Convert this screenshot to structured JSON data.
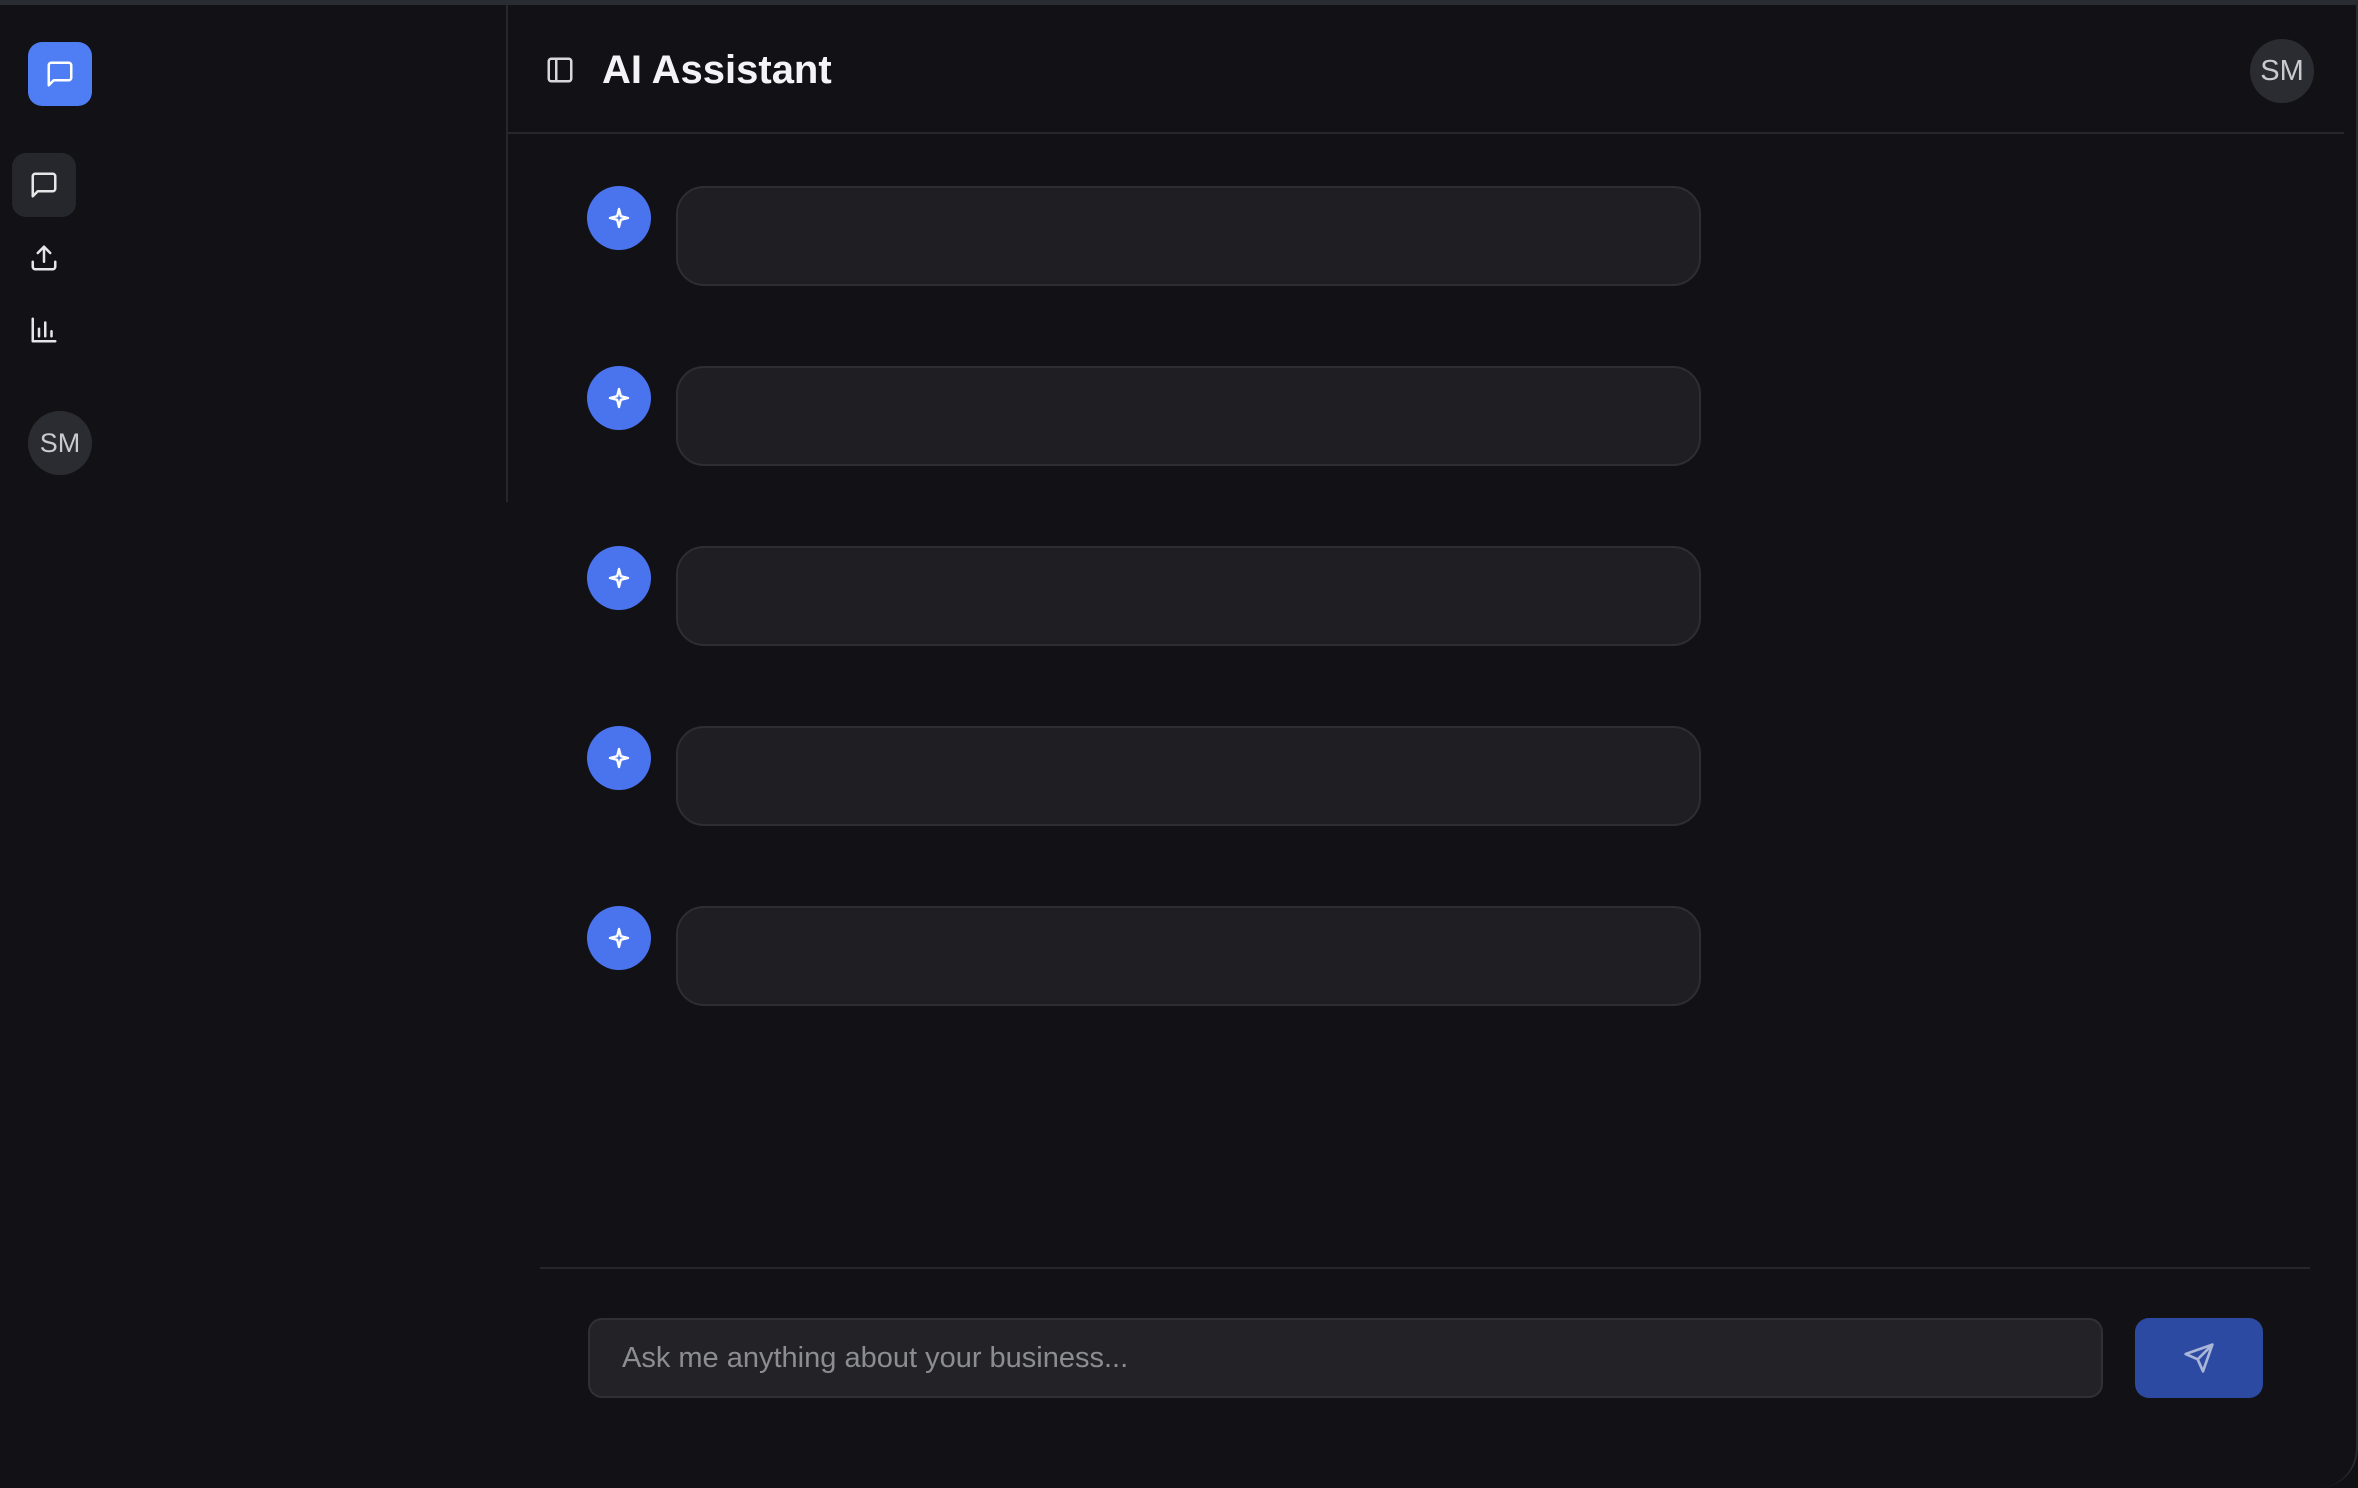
{
  "header": {
    "title": "AI Assistant",
    "avatar_initials": "SM"
  },
  "sidebar": {
    "logo_icon": "message-square-icon",
    "items": [
      {
        "id": "chat",
        "icon": "message-square-icon",
        "active": true
      },
      {
        "id": "upload",
        "icon": "upload-icon",
        "active": false
      },
      {
        "id": "analytics",
        "icon": "bar-chart-icon",
        "active": false
      }
    ],
    "avatar_initials": "SM"
  },
  "messages": [
    {
      "role": "assistant",
      "icon": "sparkle-icon",
      "text": ""
    },
    {
      "role": "assistant",
      "icon": "sparkle-icon",
      "text": ""
    },
    {
      "role": "assistant",
      "icon": "sparkle-icon",
      "text": ""
    },
    {
      "role": "assistant",
      "icon": "sparkle-icon",
      "text": ""
    },
    {
      "role": "assistant",
      "icon": "sparkle-icon",
      "text": ""
    }
  ],
  "composer": {
    "placeholder": "Ask me anything about your business...",
    "value": "",
    "send_icon": "send-icon"
  },
  "colors": {
    "accent": "#4f7df3",
    "send_button": "#2c4aa1",
    "background": "#121216",
    "bubble": "#1f1f23"
  }
}
